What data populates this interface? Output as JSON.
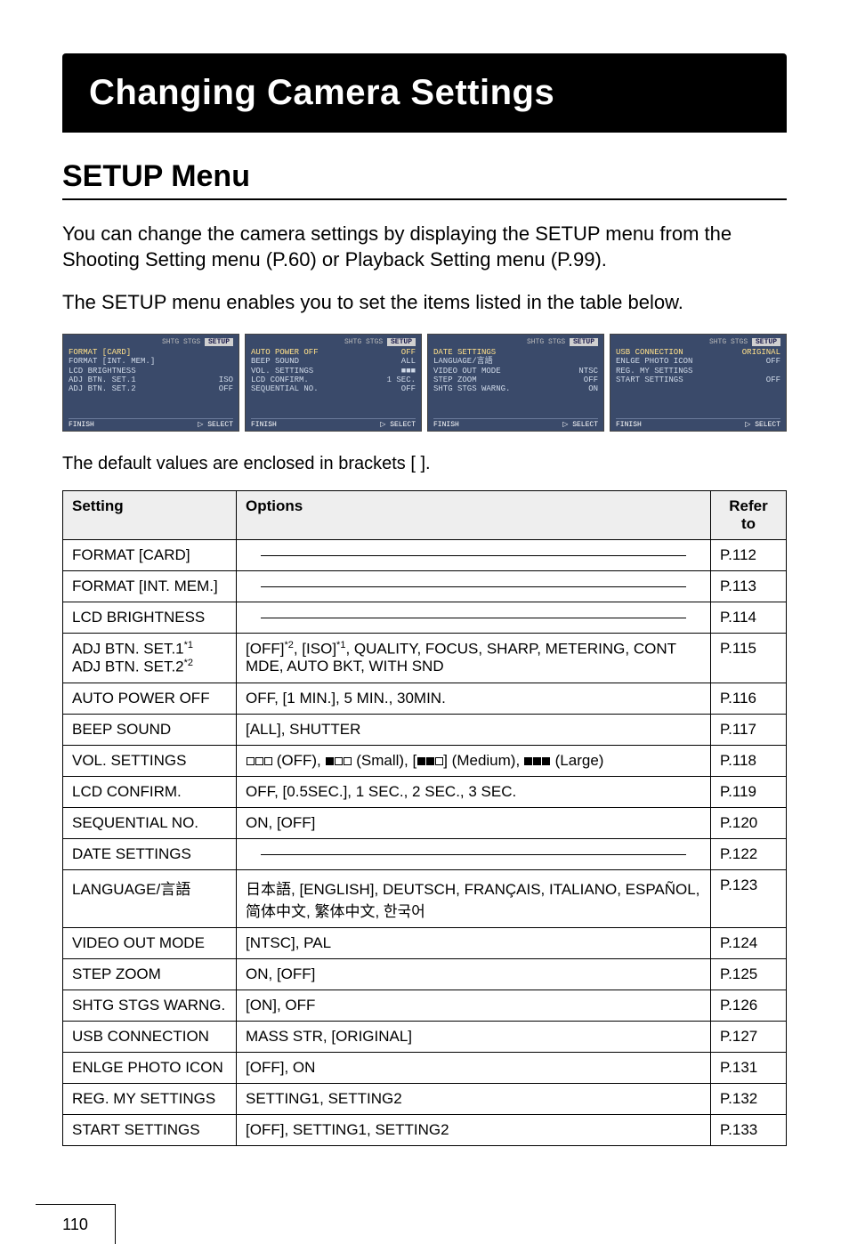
{
  "header": {
    "title": "Changing Camera Settings"
  },
  "section": {
    "title": "SETUP Menu"
  },
  "intro1": "You can change the camera settings by displaying the SETUP menu from the Shooting Setting menu (P.60) or Playback Setting menu (P.99).",
  "intro2": "The SETUP menu enables you to set the items listed in the table below.",
  "caption": "The default values are enclosed in brackets [ ].",
  "screens": {
    "topbar_setup": "SETUP",
    "finish": "FINISH",
    "select": "SELECT",
    "shtg": "SHTG STGS",
    "s1": {
      "i1": {
        "l": "FORMAT [CARD]",
        "r": ""
      },
      "i2": {
        "l": "FORMAT [INT. MEM.]",
        "r": ""
      },
      "i3": {
        "l": "LCD BRIGHTNESS",
        "r": ""
      },
      "i4": {
        "l": "ADJ BTN. SET.1",
        "r": "ISO"
      },
      "i5": {
        "l": "ADJ BTN. SET.2",
        "r": "OFF"
      }
    },
    "s2": {
      "i1": {
        "l": "AUTO POWER OFF",
        "r": "OFF"
      },
      "i2": {
        "l": "BEEP SOUND",
        "r": "ALL"
      },
      "i3": {
        "l": "VOL. SETTINGS",
        "r": "■■■"
      },
      "i4": {
        "l": "LCD CONFIRM.",
        "r": "1 SEC."
      },
      "i5": {
        "l": "SEQUENTIAL NO.",
        "r": "OFF"
      }
    },
    "s3": {
      "i1": {
        "l": "DATE SETTINGS",
        "r": ""
      },
      "i2": {
        "l": "LANGUAGE/言語",
        "r": ""
      },
      "i3": {
        "l": "VIDEO OUT MODE",
        "r": "NTSC"
      },
      "i4": {
        "l": "STEP ZOOM",
        "r": "OFF"
      },
      "i5": {
        "l": "SHTG STGS WARNG.",
        "r": "ON"
      }
    },
    "s4": {
      "i1": {
        "l": "USB CONNECTION",
        "r": "ORIGINAL"
      },
      "i2": {
        "l": "ENLGE PHOTO ICON",
        "r": "OFF"
      },
      "i3": {
        "l": "REG. MY SETTINGS",
        "r": ""
      },
      "i4": {
        "l": "START SETTINGS",
        "r": "OFF"
      }
    }
  },
  "table": {
    "h1": "Setting",
    "h2": "Options",
    "h3": "Refer to",
    "rows": [
      {
        "s": "FORMAT [CARD]",
        "o": "line",
        "r": "P.112"
      },
      {
        "s": "FORMAT [INT. MEM.]",
        "o": "line",
        "r": "P.113"
      },
      {
        "s": "LCD BRIGHTNESS",
        "o": "line",
        "r": "P.114"
      },
      {
        "s": "ADJ BTN. SET.1*1\nADJ BTN. SET.2*2",
        "o": "[OFF]*2, [ISO]*1, QUALITY, FOCUS, SHARP, METERING, CONT MDE, AUTO BKT, WITH SND",
        "r": "P.115"
      },
      {
        "s": "AUTO POWER OFF",
        "o": "OFF, [1 MIN.], 5 MIN., 30MIN.",
        "r": "P.116"
      },
      {
        "s": "BEEP SOUND",
        "o": "[ALL], SHUTTER",
        "r": "P.117"
      },
      {
        "s": "VOL. SETTINGS",
        "o": "boxes",
        "r": "P.118"
      },
      {
        "s": "LCD CONFIRM.",
        "o": "OFF, [0.5SEC.], 1 SEC., 2 SEC., 3 SEC.",
        "r": "P.119"
      },
      {
        "s": "SEQUENTIAL NO.",
        "o": "ON, [OFF]",
        "r": "P.120"
      },
      {
        "s": "DATE SETTINGS",
        "o": "line",
        "r": "P.122"
      },
      {
        "s": "LANGUAGE/言語",
        "o": "日本語, [ENGLISH], DEUTSCH, FRANÇAIS, ITALIANO, ESPAÑOL, 简体中文, 繁体中文, 한국어",
        "r": "P.123"
      },
      {
        "s": "VIDEO OUT MODE",
        "o": "[NTSC], PAL",
        "r": "P.124"
      },
      {
        "s": "STEP ZOOM",
        "o": "ON, [OFF]",
        "r": "P.125"
      },
      {
        "s": "SHTG STGS WARNG.",
        "o": "[ON], OFF",
        "r": "P.126"
      },
      {
        "s": "USB CONNECTION",
        "o": "MASS STR, [ORIGINAL]",
        "r": "P.127"
      },
      {
        "s": "ENLGE PHOTO ICON",
        "o": "[OFF], ON",
        "r": "P.131"
      },
      {
        "s": "REG. MY SETTINGS",
        "o": "SETTING1, SETTING2",
        "r": "P.132"
      },
      {
        "s": "START SETTINGS",
        "o": "[OFF], SETTING1, SETTING2",
        "r": "P.133"
      }
    ]
  },
  "boxes_text": {
    "off": " (OFF), ",
    "small": " (Small), [",
    "medium": "] (Medium), ",
    "large": " (Large)"
  },
  "page_number": "110"
}
